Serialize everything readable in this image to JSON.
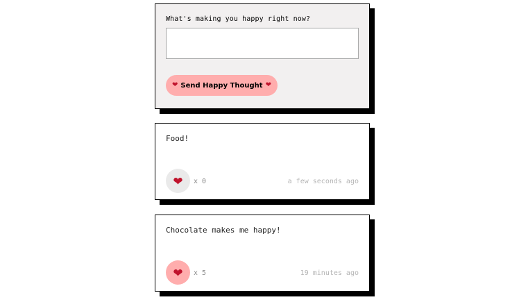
{
  "form": {
    "label": "What's making you happy right now?",
    "input_value": "",
    "input_placeholder": "",
    "button_label": "Send Happy Thought",
    "heart_glyph": "❤",
    "button_color": "#ffadad"
  },
  "thoughts": [
    {
      "message": "Food!",
      "like_prefix": "x",
      "like_count": "0",
      "timestamp": "a few seconds ago",
      "liked": false,
      "heart_icon": "heart-icon"
    },
    {
      "message": "Chocolate makes me happy!",
      "like_prefix": "x",
      "like_count": "5",
      "timestamp": "19 minutes ago",
      "liked": true,
      "heart_icon": "heart-icon"
    }
  ],
  "colors": {
    "liked_background": "#ffadad",
    "unliked_background": "#eaeaea",
    "heart": "#c0132c",
    "form_background": "#f2f0f0"
  }
}
